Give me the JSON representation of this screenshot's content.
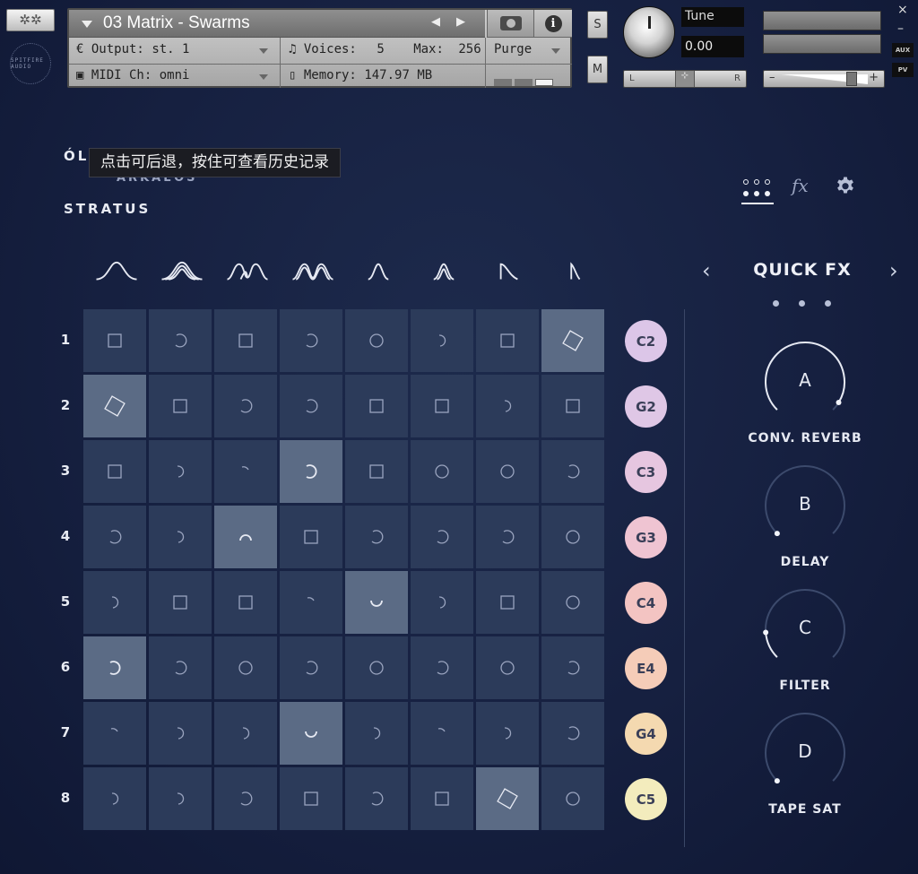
{
  "header": {
    "logo_glyph": "✲✲",
    "brand_ring": "SPITFIRE AUDIO",
    "instrument_title": "03 Matrix - Swarms",
    "nav_prev": "◀",
    "nav_next": "▶",
    "output_label": "Output:",
    "output_value": "st. 1",
    "voices_label": "Voices:",
    "voices_value": "5",
    "max_label": "Max:",
    "max_value": "256",
    "purge_label": "Purge",
    "midi_label": "MIDI Ch:",
    "midi_value": "omni",
    "memory_label": "Memory:",
    "memory_value": "147.97 MB",
    "solo_label": "S",
    "mute_label": "M",
    "tune_label": "Tune",
    "tune_value": "0.00",
    "pan_left": "L",
    "pan_right": "R",
    "vol_minus": "–",
    "vol_plus": "+",
    "close_label": "×",
    "minimize_label": "–",
    "aux_label": "AUX",
    "pv_label": "PV"
  },
  "tabs": {
    "tab1_partial": "ÓL",
    "tab2_partial": "ARKAEOS",
    "tab3": "STRATUS"
  },
  "tooltip": "点击可后退，按住可查看历史记录",
  "view": {
    "fx_label": "fx"
  },
  "grid": {
    "row_numbers": [
      "1",
      "2",
      "3",
      "4",
      "5",
      "6",
      "7",
      "8"
    ],
    "note_badges": [
      {
        "label": "C2",
        "color": "#dcc6e8"
      },
      {
        "label": "G2",
        "color": "#dfc7e6"
      },
      {
        "label": "C3",
        "color": "#e6c6e0"
      },
      {
        "label": "G3",
        "color": "#efc4d2"
      },
      {
        "label": "C4",
        "color": "#f3c4c2"
      },
      {
        "label": "E4",
        "color": "#f5ccb8"
      },
      {
        "label": "G4",
        "color": "#f4d9b0"
      },
      {
        "label": "C5",
        "color": "#f3ecbd"
      }
    ],
    "active_cells": [
      [
        0,
        7
      ],
      [
        1,
        0
      ],
      [
        2,
        3
      ],
      [
        3,
        2
      ],
      [
        4,
        4
      ],
      [
        5,
        0
      ],
      [
        6,
        3
      ],
      [
        7,
        6
      ]
    ],
    "wave_shapes": [
      "bell-wide",
      "bell-stacked",
      "double-bell",
      "double-bell-stacked",
      "spike-narrow",
      "spike-stacked",
      "decay-curve",
      "decay-sharp"
    ],
    "cell_icons": [
      [
        "square",
        "arc",
        "square",
        "arc",
        "circle",
        "arc-small",
        "square",
        "diamond"
      ],
      [
        "diamond",
        "square",
        "arc",
        "arc",
        "square",
        "square",
        "arc-small",
        "square"
      ],
      [
        "square",
        "arc-small",
        "arc-tiny",
        "arc-big",
        "square",
        "circle",
        "circle",
        "arc"
      ],
      [
        "arc",
        "arc-small",
        "arc-top",
        "square",
        "arc",
        "arc",
        "arc",
        "circle"
      ],
      [
        "arc-small",
        "square",
        "square",
        "arc-tiny",
        "arc-bottom",
        "arc-small",
        "square",
        "circle"
      ],
      [
        "arc-big",
        "arc",
        "circle",
        "arc",
        "circle",
        "arc",
        "circle",
        "arc"
      ],
      [
        "arc-tiny",
        "arc-small",
        "arc-small",
        "arc-bottom",
        "arc-small",
        "arc-tiny",
        "arc-small",
        "arc"
      ],
      [
        "arc-small",
        "arc-small",
        "arc",
        "square",
        "arc",
        "square",
        "diamond",
        "circle"
      ]
    ]
  },
  "quick_fx": {
    "title": "QUICK FX",
    "prev_arrow": "‹",
    "next_arrow": "›",
    "page_dots": 3,
    "knobs": [
      {
        "letter": "A",
        "label": "CONV. REVERB",
        "value": 0.95
      },
      {
        "letter": "B",
        "label": "DELAY",
        "value": 0.0
      },
      {
        "letter": "C",
        "label": "FILTER",
        "value": 0.15
      },
      {
        "letter": "D",
        "label": "TAPE SAT",
        "value": 0.0
      }
    ]
  }
}
